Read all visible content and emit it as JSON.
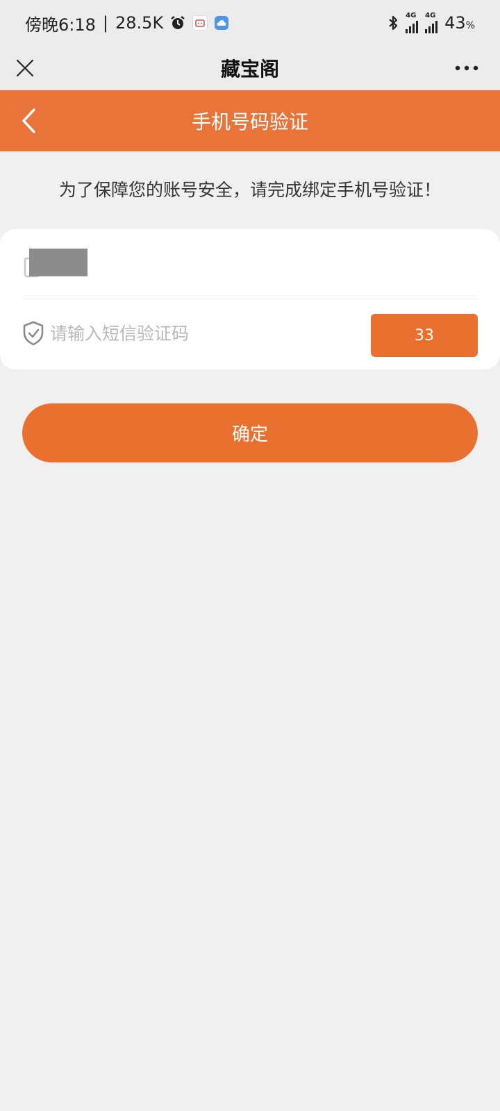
{
  "status_bar": {
    "time_text": "傍晚6:18",
    "separator": "|",
    "speed_text": "28.5K",
    "net1_label": "4G",
    "net2_label": "4G",
    "battery_text": "43",
    "battery_unit": "%",
    "icons": [
      "alarm-icon",
      "app-badge-icon",
      "cloud-icon",
      "bluetooth-icon",
      "signal-icon",
      "signal-icon"
    ]
  },
  "app_header": {
    "title": "藏宝阁",
    "close_icon": "close-icon",
    "more_icon": "more-icon"
  },
  "page_header": {
    "title": "手机号码验证",
    "back_icon": "chevron-left-icon"
  },
  "notice": {
    "text": "为了保障您的账号安全，请完成绑定手机号验证！"
  },
  "form": {
    "phone_icon": "phone-icon",
    "phone_value": "",
    "code_icon": "shield-check-icon",
    "code_placeholder": "请输入短信验证码",
    "code_value": "",
    "countdown_label": "33"
  },
  "confirm": {
    "label": "确定"
  },
  "colors": {
    "accent": "#ea702f",
    "header_orange": "#e8743a",
    "background": "#f0f0f0"
  }
}
